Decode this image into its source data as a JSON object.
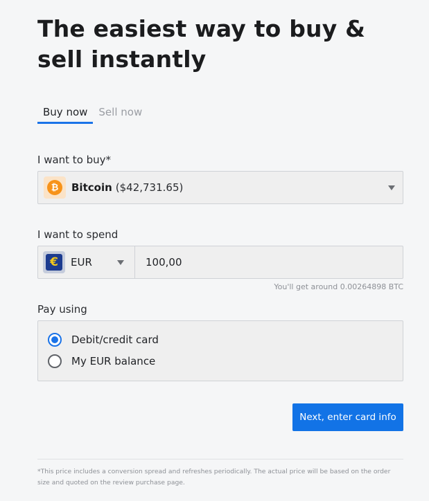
{
  "headline": "The easiest way to buy & sell instantly",
  "tabs": [
    {
      "label": "Buy now",
      "active": true
    },
    {
      "label": "Sell now",
      "active": false
    }
  ],
  "buy": {
    "label": "I want to buy*",
    "asset_icon": "bitcoin-icon",
    "asset_icon_glyph": "₿",
    "asset_name": "Bitcoin",
    "asset_price": "($42,731.65)"
  },
  "spend": {
    "label": "I want to spend",
    "currency_icon": "euro-icon",
    "currency_icon_glyph": "€",
    "currency_code": "EUR",
    "amount": "100,00",
    "estimate": "You'll get around 0.00264898 BTC"
  },
  "pay": {
    "label": "Pay using",
    "options": [
      {
        "label": "Debit/credit card",
        "selected": true
      },
      {
        "label": "My EUR balance",
        "selected": false
      }
    ]
  },
  "next_button": "Next, enter card info",
  "footnote": "*This price includes a conversion spread and refreshes periodically. The actual price will be based on the order size and quoted on the review purchase page.",
  "colors": {
    "accent": "#1273e6",
    "bitcoin": "#f7931a",
    "euro_bg": "#1c3b8f",
    "euro_fg": "#f3c81b",
    "background": "#f5f6f7"
  }
}
